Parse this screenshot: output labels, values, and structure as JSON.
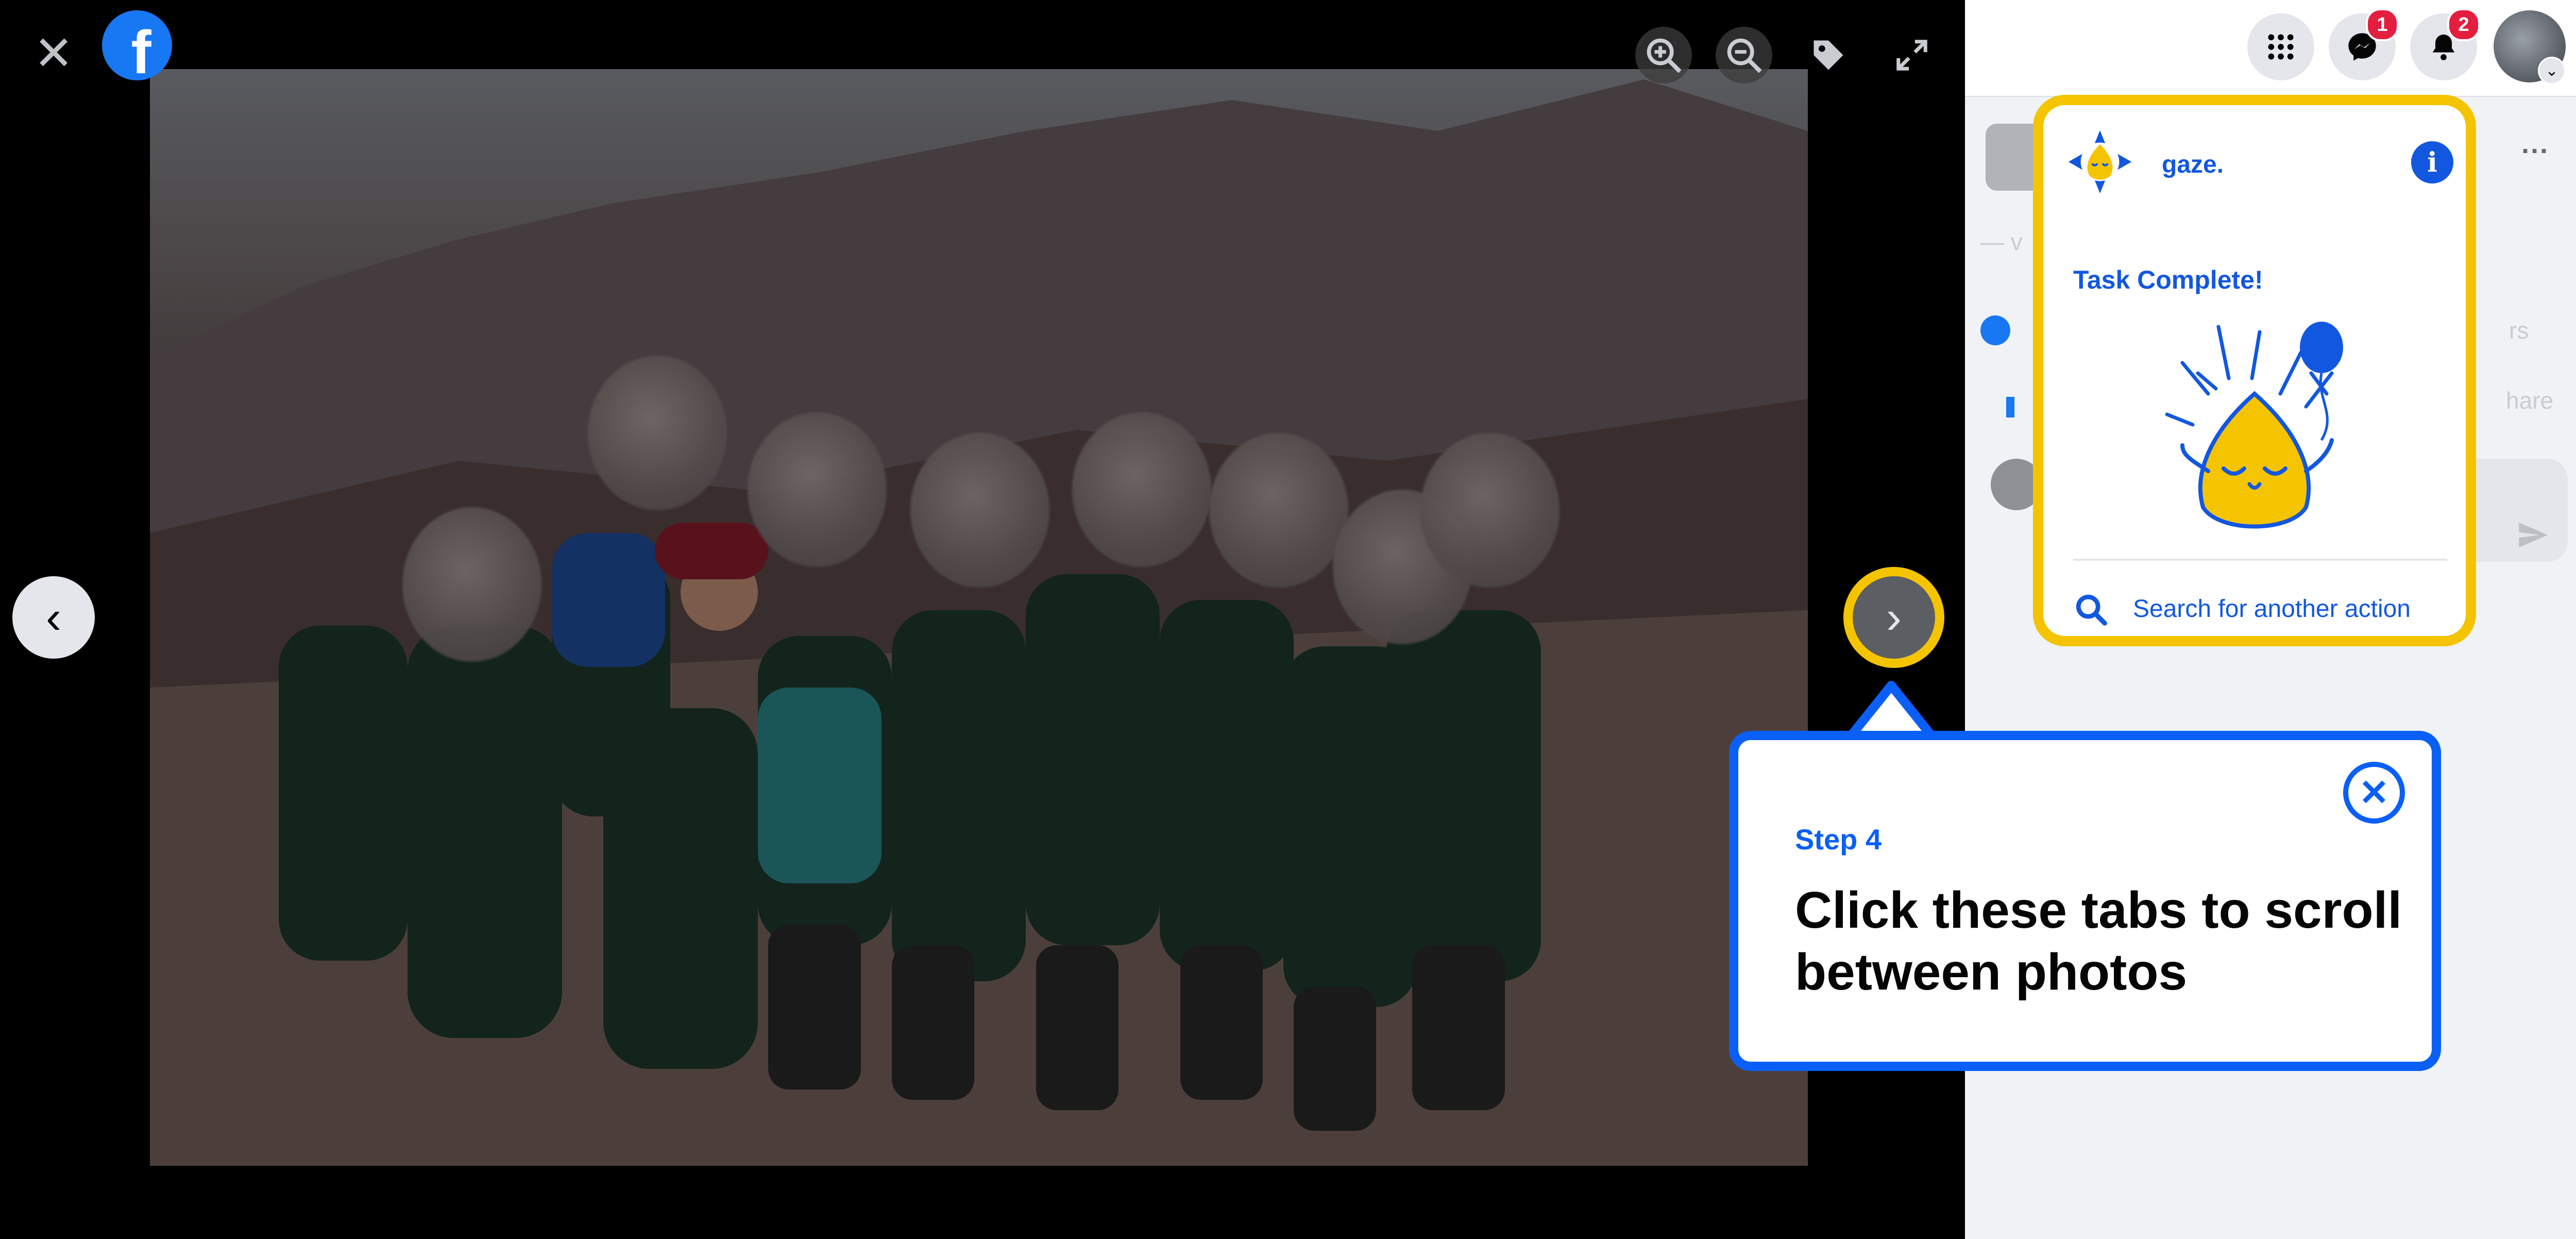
{
  "viewer": {
    "close_glyph": "✕",
    "logo_letter": "f",
    "prev_glyph": "‹",
    "next_glyph": "›",
    "tools": [
      "zoom-in-icon",
      "zoom-out-icon",
      "tag-icon",
      "fullscreen-icon"
    ]
  },
  "topbar": {
    "messenger_badge": "1",
    "notifications_badge": "2",
    "account_chevron": "⌄"
  },
  "post_fragments": {
    "dash": "— v",
    "menu_dots": "···",
    "reactions_suffix": "rs",
    "share_suffix": "hare"
  },
  "gaze_panel": {
    "name": "gaze.",
    "info_glyph": "i",
    "status": "Task Complete!",
    "search_label": "Search for another action"
  },
  "tooltip": {
    "step": "Step 4",
    "message": "Click these tabs to scroll between photos",
    "close_glyph": "✕"
  },
  "colors": {
    "facebook_blue": "#1877f2",
    "gaze_yellow": "#f5c400",
    "gaze_blue": "#1257e0",
    "tooltip_blue": "#0a5ff7",
    "badge_red": "#e41e3f"
  }
}
